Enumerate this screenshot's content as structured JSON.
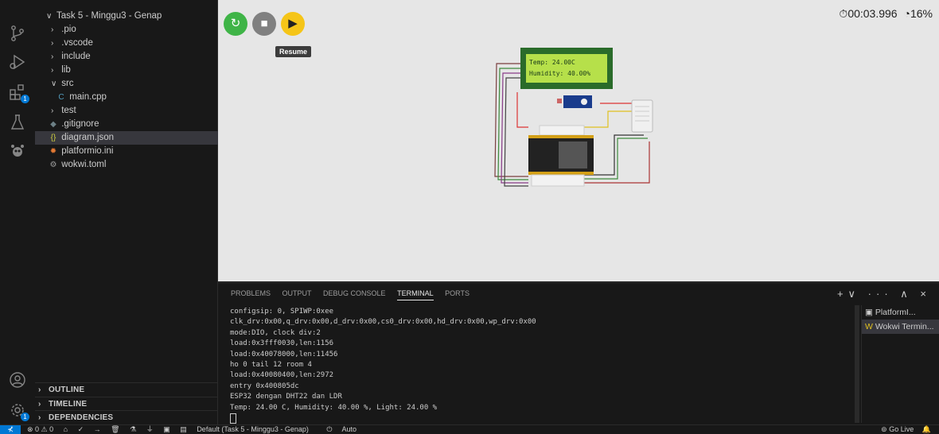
{
  "explorer": {
    "root_label": "Task 5 - Minggu3 - Genap",
    "items": [
      {
        "label": ".pio",
        "kind": "folder"
      },
      {
        "label": ".vscode",
        "kind": "folder"
      },
      {
        "label": "include",
        "kind": "folder"
      },
      {
        "label": "lib",
        "kind": "folder"
      },
      {
        "label": "src",
        "kind": "folder-open"
      },
      {
        "label": "main.cpp",
        "kind": "cpp"
      },
      {
        "label": "test",
        "kind": "folder"
      },
      {
        "label": ".gitignore",
        "kind": "git"
      },
      {
        "label": "diagram.json",
        "kind": "json"
      },
      {
        "label": "platformio.ini",
        "kind": "ini"
      },
      {
        "label": "wokwi.toml",
        "kind": "gear"
      }
    ],
    "sections": [
      "OUTLINE",
      "TIMELINE",
      "DEPENDENCIES"
    ],
    "selected": "diagram.json"
  },
  "activity_bar": {
    "icons": [
      "source-control-icon",
      "run-debug-icon",
      "extensions-icon",
      "testing-icon",
      "platformio-icon"
    ],
    "extensions_badge": "1",
    "accounts_badge": "1"
  },
  "simulator": {
    "restart_icon": "↻",
    "stop_icon": "■",
    "resume_icon": "▶",
    "tooltip": "Resume",
    "timer": "00:03.996",
    "speed": "16%",
    "lcd_line1": "Temp: 24.00C",
    "lcd_line2": "Humidity: 40.00%",
    "colors": {
      "restart": "#3fb447",
      "stop": "#808080",
      "resume": "#f5c518",
      "lcd": "#b6e04a"
    }
  },
  "panel": {
    "tabs": [
      "PROBLEMS",
      "OUTPUT",
      "DEBUG CONSOLE",
      "TERMINAL",
      "PORTS"
    ],
    "active_tab": "TERMINAL",
    "actions": "+∨ ··· ∧ ×",
    "terminal_lines": [
      "configsip: 0, SPIWP:0xee",
      "clk_drv:0x00,q_drv:0x00,d_drv:0x00,cs0_drv:0x00,hd_drv:0x00,wp_drv:0x00",
      "mode:DIO, clock div:2",
      "load:0x3fff0030,len:1156",
      "load:0x40078000,len:11456",
      "ho 0 tail 12 room 4",
      "load:0x40080400,len:2972",
      "entry 0x400805dc",
      "ESP32 dengan DHT22 dan LDR",
      "Temp: 24.00 C, Humidity: 40.00 %, Light: 24.00 %"
    ],
    "terminal_list": [
      "PlatformI...",
      "Wokwi Termin..."
    ]
  },
  "statusbar": {
    "remote": "⊀",
    "problems": "⊗ 0 ⚠ 0",
    "env": "Default (Task 5 - Minggu3 - Genap)",
    "auto": "Auto",
    "go_live": "Go Live"
  }
}
